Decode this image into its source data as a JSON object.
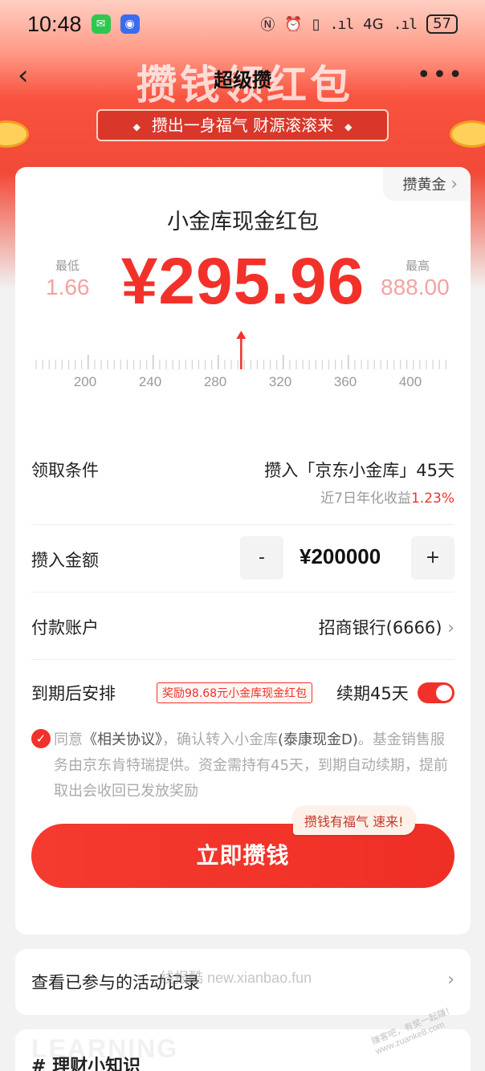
{
  "status_bar": {
    "time": "10:48",
    "battery": "57",
    "network": "4G"
  },
  "nav": {
    "title": "超级攒",
    "banner_text": "攒钱领红包",
    "back_icon": "chevron-left-icon",
    "more_icon": "more-dots-icon"
  },
  "slogan": "攒出一身福气 财源滚滚来",
  "card": {
    "gold_tag": "攒黄金",
    "title": "小金库现金红包",
    "min_label": "最低",
    "min_value": "1.66",
    "amount": "¥295.96",
    "max_label": "最高",
    "max_value": "888.00",
    "ruler_labels": [
      "200",
      "240",
      "280",
      "320",
      "360",
      "400"
    ],
    "ruler_pointer_value": 295.96,
    "condition": {
      "label": "领取条件",
      "value": "攒入「京东小金库」45天",
      "yield_label": "近7日年化收益",
      "yield_rate": "1.23%"
    },
    "deposit": {
      "label": "攒入金额",
      "minus": "-",
      "value": "¥200000",
      "plus": "+"
    },
    "account": {
      "label": "付款账户",
      "value": "招商银行(6666)"
    },
    "maturity": {
      "label": "到期后安排",
      "reward_tag": "奖励98.68元小金库现金红包",
      "renew": "续期45天",
      "toggle_on": true
    },
    "agreement": {
      "prefix": "同意",
      "link": "《相关协议》",
      "text1": "，确认转入小金库",
      "fund": "(泰康现金D)",
      "text2": "。基金销售服务由京东肯特瑞提供。资金需持有45天，到期自动续期，提前取出会收回已发放奖励"
    },
    "bubble": "攒钱有福气 速来!",
    "cta": "立即攒钱"
  },
  "records": {
    "label": "查看已参与的活动记录",
    "watermark": "线报酷 new.xianbao.fun"
  },
  "knowledge": {
    "ghost": "LEARNING",
    "label": "# 理财小知识"
  },
  "watermark_corner": "赚客吧，有奖一起赚！ www.zuanke8.com",
  "colors": {
    "accent": "#f2312a",
    "hero": "#f24a38"
  }
}
